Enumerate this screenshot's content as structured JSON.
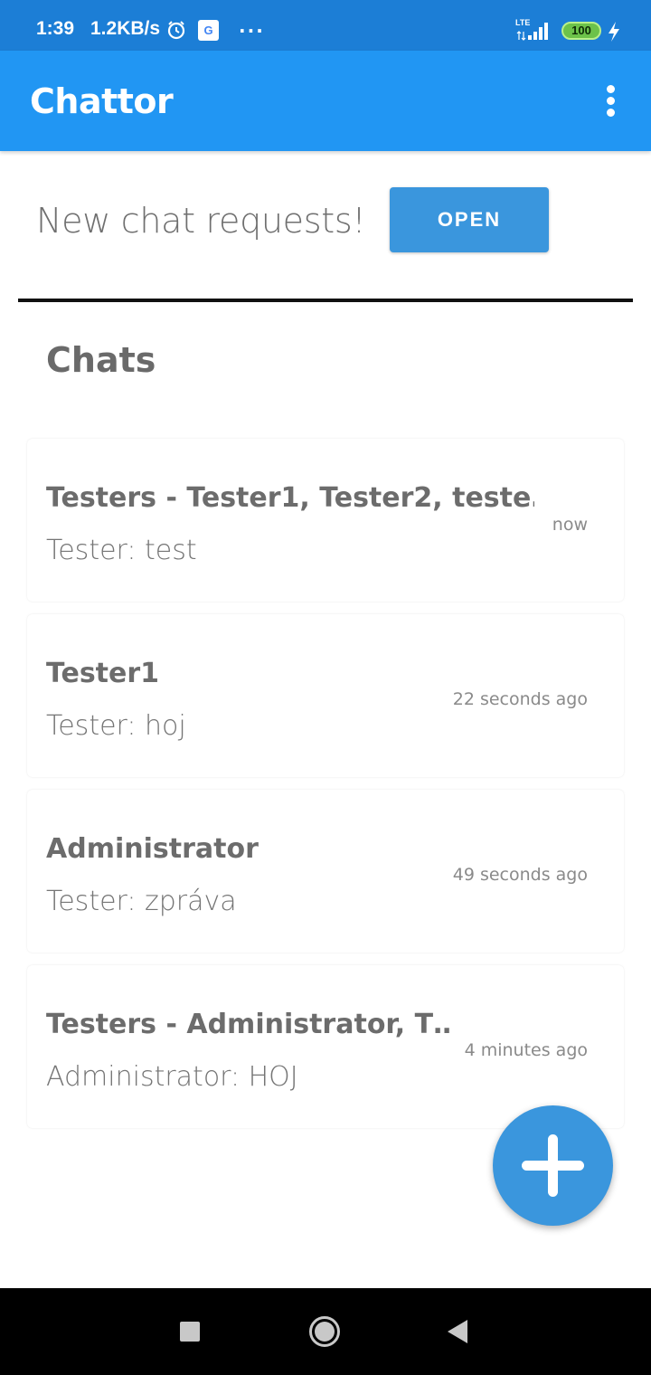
{
  "status_bar": {
    "time": "1:39",
    "network_speed": "1.2KB/s",
    "google_badge": "G",
    "more_indicator": "···",
    "network_type": "LTE",
    "battery_level": "100",
    "colors": {
      "background": "#1c7ed6",
      "battery": "#6cc24a"
    }
  },
  "app_bar": {
    "title": "Chattor",
    "menu_icon": "more-vert-icon",
    "color": "#2196f3"
  },
  "requests": {
    "text": "New chat requests!",
    "button_label": "OPEN",
    "button_color": "#3a96dd"
  },
  "chats_section": {
    "title": "Chats",
    "items": [
      {
        "name": "Testers - Tester1, Tester2, teste…",
        "preview": "Tester: test",
        "time": "now"
      },
      {
        "name": "Tester1",
        "preview": "Tester: hoj",
        "time": "22 seconds ago"
      },
      {
        "name": "Administrator",
        "preview": "Tester: zpráva",
        "time": "49 seconds ago"
      },
      {
        "name": "Testers - Administrator, T…",
        "preview": "Administrator: HOJ",
        "time": "4 minutes ago"
      }
    ]
  },
  "fab": {
    "icon": "plus-icon"
  },
  "nav_bar": {
    "recents_icon": "square-icon",
    "home_icon": "circle-icon",
    "back_icon": "triangle-back-icon"
  }
}
